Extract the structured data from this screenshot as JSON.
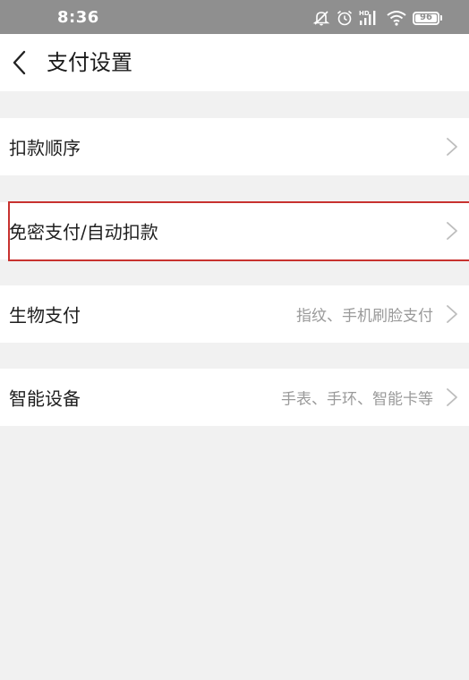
{
  "status_bar": {
    "time": "8:36",
    "battery_level": "96",
    "icons": [
      "mute-bell-icon",
      "alarm-icon",
      "hd-signal-icon",
      "wifi-icon",
      "battery-icon"
    ]
  },
  "header": {
    "title": "支付设置",
    "back_icon": "chevron-left-icon"
  },
  "settings": {
    "items": [
      {
        "label": "扣款顺序",
        "value": ""
      },
      {
        "label": "免密支付/自动扣款",
        "value": ""
      },
      {
        "label": "生物支付",
        "value": "指纹、手机刷脸支付"
      },
      {
        "label": "智能设备",
        "value": "手表、手环、智能卡等"
      }
    ]
  },
  "colors": {
    "status_bar_bg": "#8f8f8f",
    "page_bg": "#f1f1f1",
    "row_bg": "#ffffff",
    "highlight_border": "#c8322f",
    "secondary_text": "#9a9a9a"
  }
}
